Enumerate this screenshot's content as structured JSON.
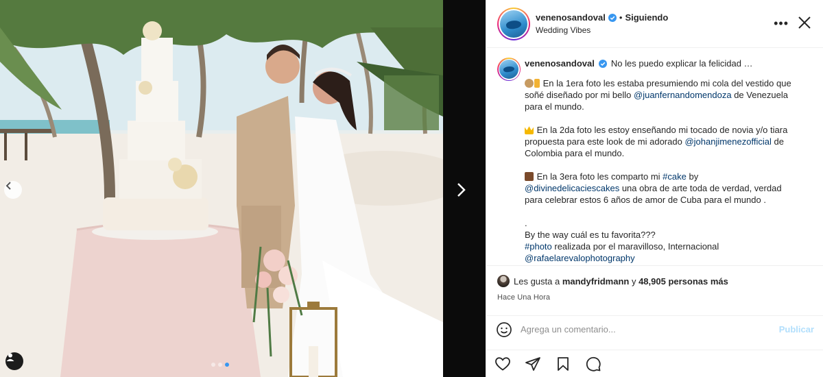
{
  "post": {
    "username": "venenosandoval",
    "follow_separator": "•",
    "follow_status": "Siguiendo",
    "location": "Wedding Vibes",
    "more_label": "•••"
  },
  "caption": {
    "username": "venenosandoval",
    "first_line": "No les puedo explicar la felicidad …",
    "p1_text1": "En la 1era foto les estaba presumiendo mi cola del vestido que soñé diseñado por mi bello ",
    "p1_mention": "@juanfernandomendoza",
    "p1_text2": " de Venezuela para el mundo.",
    "p2_text1": "En la 2da foto les estoy enseñando mi tocado de novia y/o tiara propuesta para este look de mi adorado ",
    "p2_mention": "@johanjimenezofficial",
    "p2_text2": " de Colombia para el mundo.",
    "p3_text1": "En la 3era foto les comparto mi ",
    "p3_hashtag": "#cake",
    "p3_text2": " by ",
    "p3_mention": "@divinedelicaciescakes",
    "p3_text3": " una obra de arte toda de verdad, verdad para celebrar estos 6 años de amor de Cuba para el mundo .",
    "p4_dot": ".",
    "p4_line": "By the way cuál es tu favorita???",
    "p5_hashtag": "#photo",
    "p5_text": " realizada por el maravilloso, Internacional",
    "p6_mention": "@rafaelarevalophotography"
  },
  "likes": {
    "prefix": "Les gusta a ",
    "user": "mandyfridmann",
    "middle": " y ",
    "count": "48,905 personas más"
  },
  "timestamp": "Hace Una Hora",
  "comment": {
    "placeholder": "Agrega un comentario...",
    "publish_label": "Publicar"
  },
  "carousel": {
    "total": 3,
    "active_index": 2
  },
  "colors": {
    "link": "#00376b",
    "verified": "#3897f0",
    "publish_disabled": "#b2dffc"
  },
  "icons": [
    "chevron-left-icon",
    "chevron-right-icon",
    "user-tag-icon",
    "verified-icon",
    "more-icon",
    "close-icon",
    "emoji-icon",
    "heart-icon",
    "share-icon",
    "bookmark-icon",
    "comment-icon"
  ]
}
